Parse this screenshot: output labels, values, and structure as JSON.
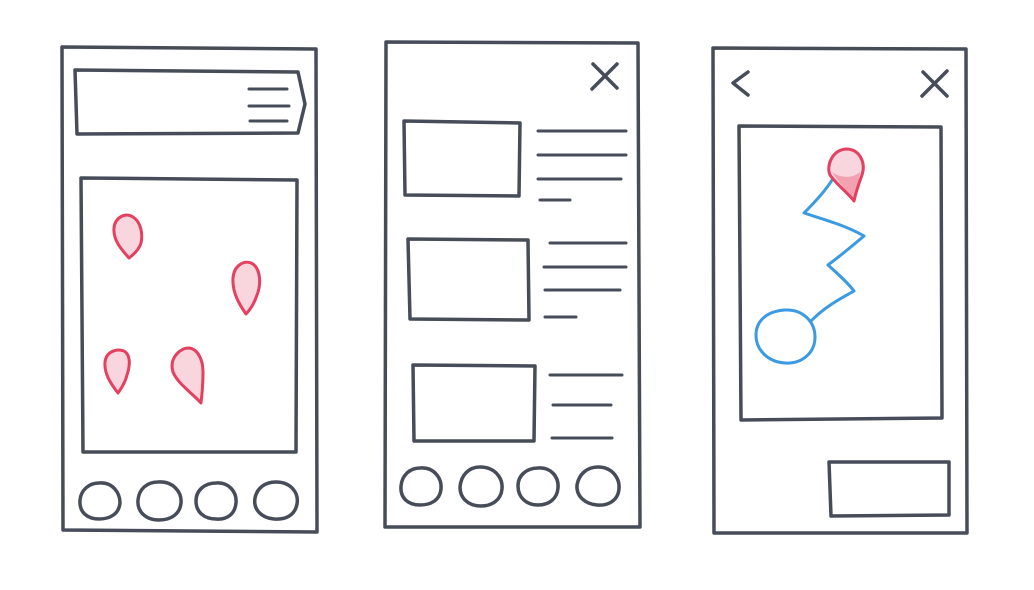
{
  "colors": {
    "ink": "#474c59",
    "pin_stroke": "#e4405f",
    "pin_fill": "#f9d6de",
    "route": "#3b9ae1",
    "background": "#ffffff"
  },
  "screens": [
    {
      "name": "map-screen",
      "header": {
        "icon": "hamburger-menu-icon"
      },
      "map": {
        "pin_count": 4,
        "pin_icon": "map-pin-icon"
      },
      "bottom_nav": {
        "item_count": 4,
        "item_icon": "nav-circle-icon"
      }
    },
    {
      "name": "list-screen",
      "header": {
        "icon": "close-icon"
      },
      "list": {
        "item_count": 3
      },
      "bottom_nav": {
        "item_count": 4,
        "item_icon": "nav-circle-icon"
      }
    },
    {
      "name": "route-screen",
      "header": {
        "left_icon": "back-chevron-icon",
        "right_icon": "close-icon"
      },
      "map": {
        "pin_icon": "map-pin-icon",
        "route_icon": "route-line-icon",
        "origin_icon": "origin-circle-icon"
      },
      "action": {
        "icon": "action-button"
      }
    }
  ]
}
